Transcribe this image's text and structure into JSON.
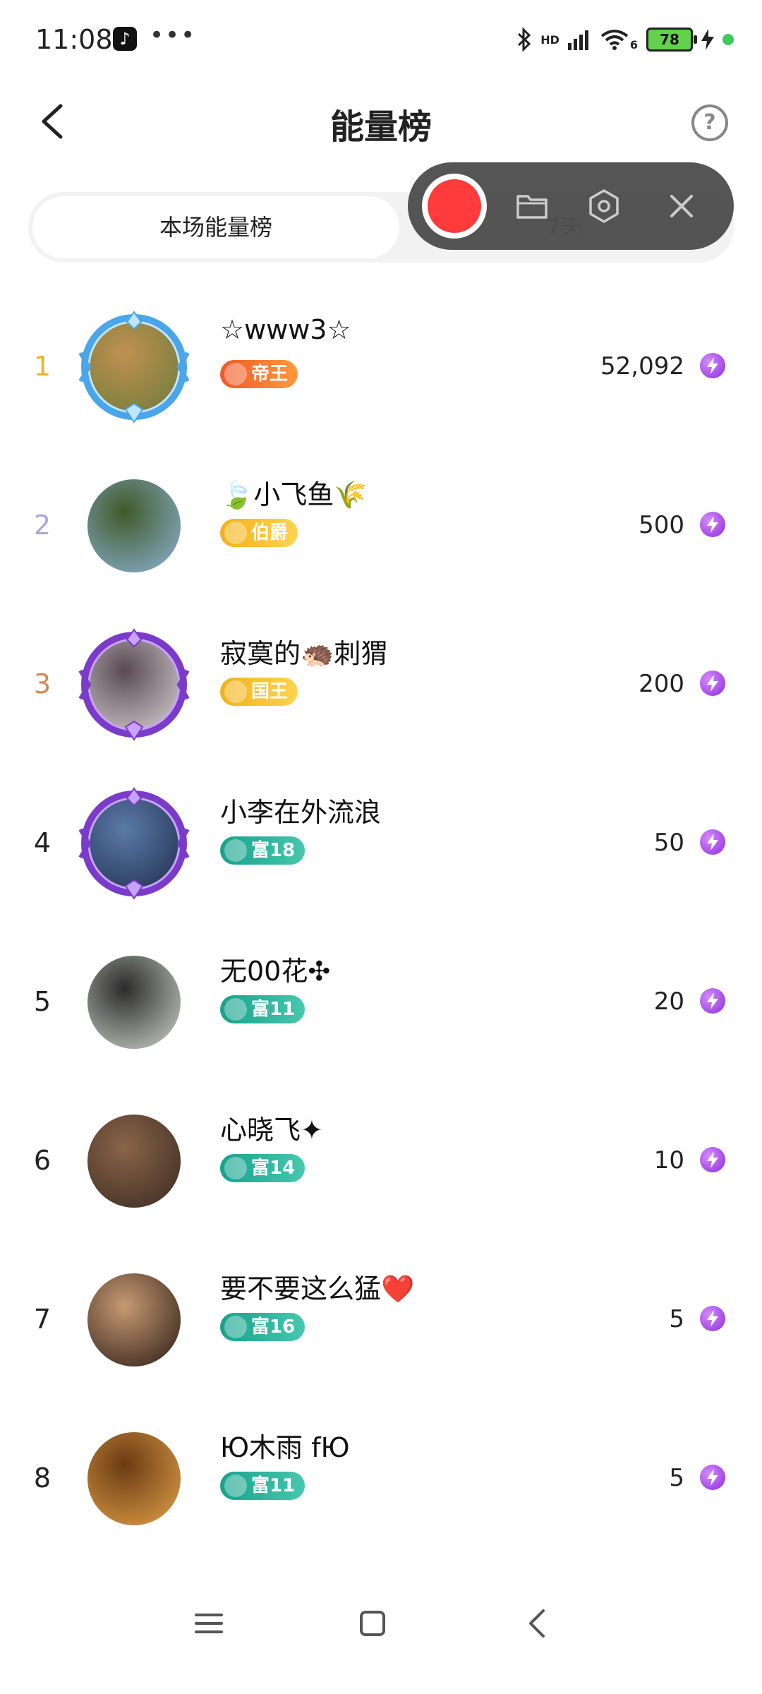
{
  "status": {
    "time": "11:08",
    "dots": "•••",
    "hd": "HD",
    "battery": "78",
    "bluetooth_icon": "bluetooth-icon",
    "signal_icon": "signal-icon",
    "wifi_icon": "wifi-icon",
    "wifi_generation": "6",
    "charging_icon": "charging-bolt-icon"
  },
  "header": {
    "title": "能量榜",
    "help": "?"
  },
  "tabs": {
    "active": "本场能量榜",
    "inactive": "7天"
  },
  "overlay": {
    "icons": [
      "record-icon",
      "folder-icon",
      "settings-hexagon-icon",
      "close-icon"
    ]
  },
  "ranking": [
    {
      "rank": "1",
      "rank_color": "#f2b21e",
      "name": "☆www3☆",
      "badge": "帝王",
      "badge_style": "orange",
      "score": "52,092",
      "avatar_colors": [
        "#6a7b3a",
        "#c09050"
      ],
      "frame": "blue"
    },
    {
      "rank": "2",
      "rank_color": "#a9a9d8",
      "name": "🍃小飞鱼🌾",
      "badge": "伯爵",
      "badge_style": "gold",
      "score": "500",
      "avatar_colors": [
        "#8fb3d6",
        "#3f5a2a"
      ],
      "frame": "none"
    },
    {
      "rank": "3",
      "rank_color": "#d08a5a",
      "name": "寂寞的🦔刺猬",
      "badge": "国王",
      "badge_style": "gold",
      "score": "200",
      "avatar_colors": [
        "#dcd6d8",
        "#5a4a52"
      ],
      "frame": "purple"
    },
    {
      "rank": "4",
      "rank_color": "#222222",
      "name": "小李在外流浪",
      "badge": "富18",
      "badge_style": "teal",
      "score": "50",
      "avatar_colors": [
        "#1f2c4a",
        "#5a7aa8"
      ],
      "frame": "purple"
    },
    {
      "rank": "5",
      "rank_color": "#222222",
      "name": "无00花✣",
      "badge": "富11",
      "badge_style": "teal",
      "score": "20",
      "avatar_colors": [
        "#cfd4cc",
        "#2b2b2b"
      ],
      "frame": "none"
    },
    {
      "rank": "6",
      "rank_color": "#222222",
      "name": "心晓飞✦",
      "badge": "富14",
      "badge_style": "teal",
      "score": "10",
      "avatar_colors": [
        "#3a2a22",
        "#8a6448"
      ],
      "frame": "none"
    },
    {
      "rank": "7",
      "rank_color": "#222222",
      "name": "要不要这么猛❤️",
      "badge": "富16",
      "badge_style": "teal",
      "score": "5",
      "avatar_colors": [
        "#2a1a14",
        "#c79a73"
      ],
      "frame": "none"
    },
    {
      "rank": "8",
      "rank_color": "#222222",
      "name": "Ю木雨 fЮ",
      "badge": "富11",
      "badge_style": "teal",
      "score": "5",
      "avatar_colors": [
        "#e2a24a",
        "#6a3a12"
      ],
      "frame": "none"
    }
  ]
}
